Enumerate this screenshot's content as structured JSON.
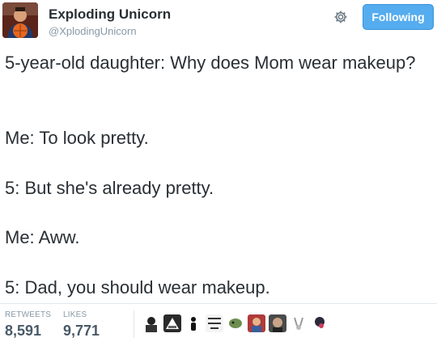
{
  "author": {
    "name": "Exploding Unicorn",
    "handle": "@XplodingUnicorn"
  },
  "actions": {
    "settings_icon": "gear-icon",
    "follow_label": "Following",
    "accent_color": "#55acee"
  },
  "tweet": {
    "lines": [
      "5-year-old daughter: Why does Mom wear makeup?",
      "Me: To look pretty.",
      "5: But she's already pretty.",
      "Me: Aww.",
      "5: Dad, you should wear makeup."
    ]
  },
  "stats": {
    "retweets_label": "RETWEETS",
    "retweets_value": "8,591",
    "likes_label": "LIKES",
    "likes_value": "9,771"
  },
  "likers": [
    "liker-avatar",
    "liker-avatar",
    "liker-avatar",
    "liker-avatar",
    "liker-avatar",
    "liker-avatar",
    "liker-avatar",
    "liker-avatar",
    "liker-avatar",
    "liker-avatar"
  ]
}
